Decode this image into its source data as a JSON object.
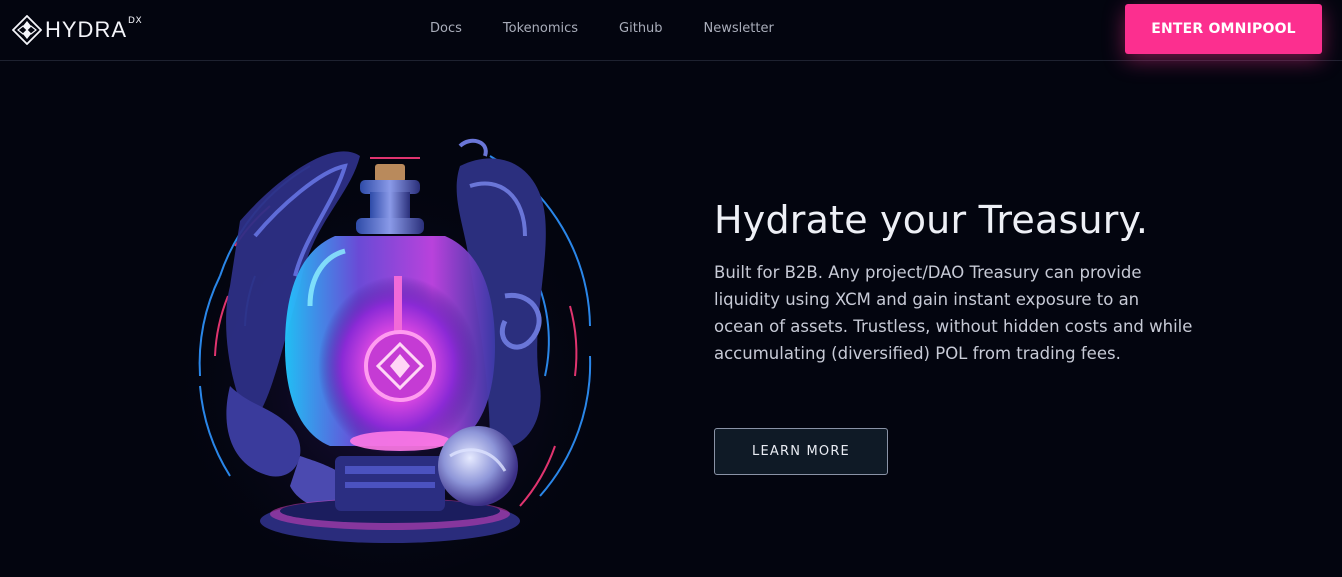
{
  "brand": {
    "name": "HYDRA",
    "superscript": "DX",
    "icon": "hydradx-logo-icon"
  },
  "nav": {
    "items": [
      {
        "label": "Docs"
      },
      {
        "label": "Tokenomics"
      },
      {
        "label": "Github"
      },
      {
        "label": "Newsletter"
      }
    ]
  },
  "header": {
    "cta_label": "ENTER OMNIPOOL"
  },
  "hero": {
    "title": "Hydrate your Treasury.",
    "description": "Built for B2B. Any project/DAO Treasury can provide liquidity using XCM and gain instant exposure to an ocean of assets. Trustless, without hidden costs and while accumulating (diversified) POL from trading fees.",
    "button_label": "LEARN MORE",
    "illustration": "glowing-potion-bottle-illustration"
  },
  "colors": {
    "background": "#03050f",
    "accent": "#fc2f8f",
    "nav_text": "#a9adba",
    "button_bg": "#0f1a26"
  }
}
